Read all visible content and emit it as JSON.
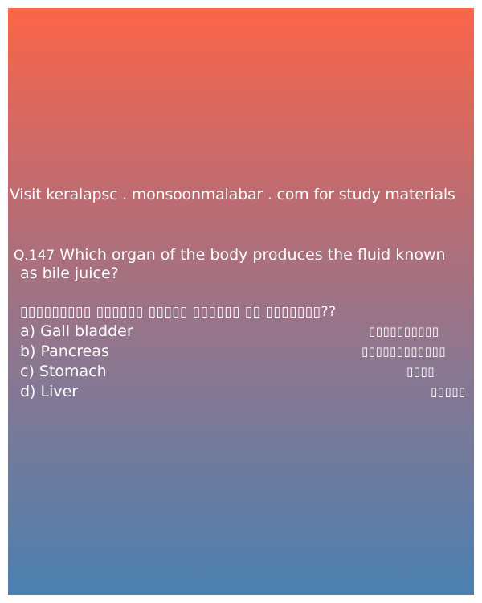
{
  "promo_text": "Visit keralapsc . monsoonmalabar . com for study materials",
  "question": {
    "number": "Q.147",
    "text_line1": "Which organ of the body produces the fluid known",
    "text_line2": "as bile juice?",
    "malayalam_text": "▯▯▯▯▯▯▯▯▯ ▯▯▯▯▯▯ ▯▯▯▯▯ ▯▯▯▯▯▯ ▯▯ ▯▯▯▯▯▯▯??"
  },
  "options": [
    {
      "label": "a) Gall bladder",
      "malayalam": "▯▯▯▯▯▯▯▯▯▯"
    },
    {
      "label": "b) Pancreas",
      "malayalam": "▯▯▯▯▯▯▯▯▯▯▯▯"
    },
    {
      "label": "c) Stomach",
      "malayalam": "▯▯▯▯"
    },
    {
      "label": "d) Liver",
      "malayalam": "▯▯▯▯▯"
    }
  ]
}
